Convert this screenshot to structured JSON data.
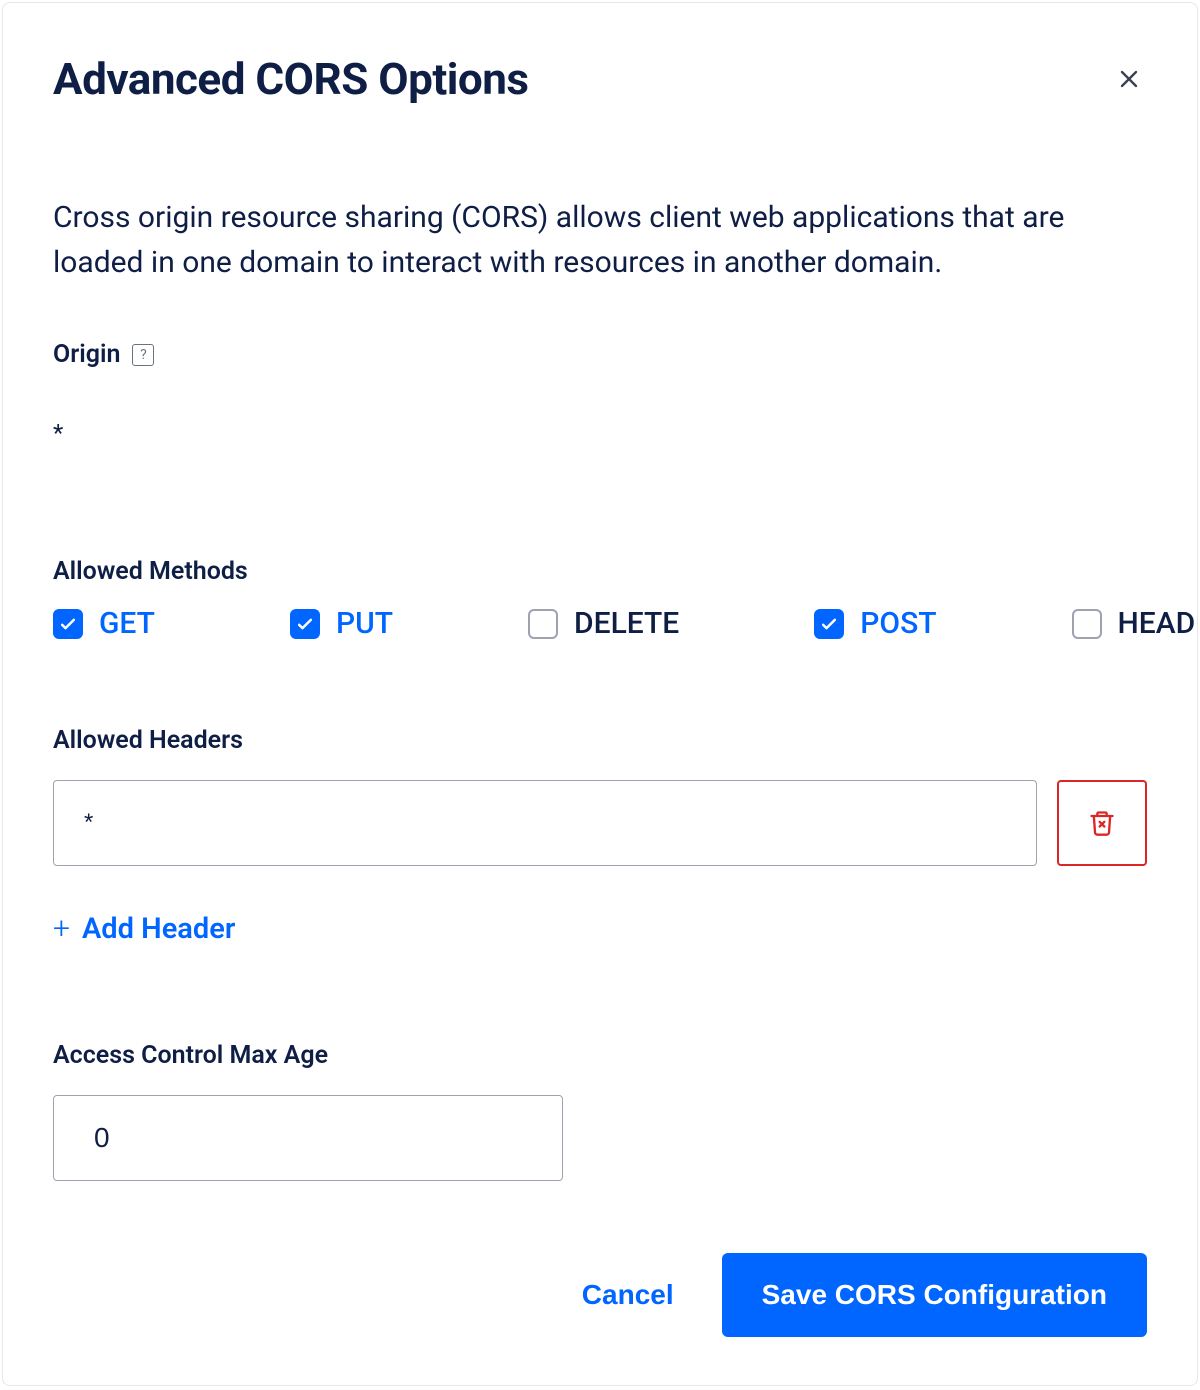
{
  "modal": {
    "title": "Advanced CORS Options",
    "description": "Cross origin resource sharing (CORS) allows client web applications that are loaded in one domain to interact with resources in another domain."
  },
  "origin": {
    "label": "Origin",
    "value": "*"
  },
  "methods": {
    "label": "Allowed Methods",
    "items": [
      {
        "name": "GET",
        "checked": true
      },
      {
        "name": "PUT",
        "checked": true
      },
      {
        "name": "DELETE",
        "checked": false
      },
      {
        "name": "POST",
        "checked": true
      },
      {
        "name": "HEAD",
        "checked": false
      }
    ]
  },
  "headers": {
    "label": "Allowed Headers",
    "items": [
      "*"
    ],
    "add_label": "Add Header"
  },
  "maxage": {
    "label": "Access Control Max Age",
    "value": "0"
  },
  "footer": {
    "cancel": "Cancel",
    "save": "Save CORS Configuration"
  }
}
